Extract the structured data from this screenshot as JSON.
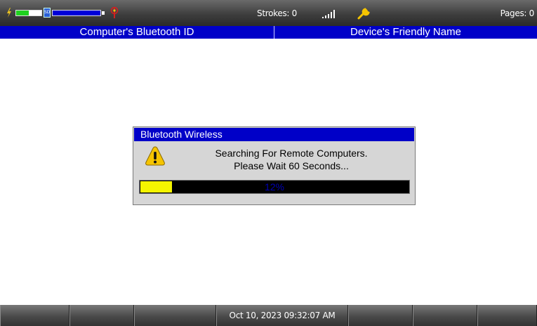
{
  "status_bar": {
    "strokes": "Strokes: 0",
    "pages": "Pages: 0",
    "icons": [
      "battery-charging-icon",
      "sd-card-icon",
      "usb-icon",
      "signal-strength-icon",
      "wrench-icon"
    ],
    "battery_level": 0.5,
    "sd_card_label": "SD",
    "storage_level": 1.0
  },
  "columns": {
    "computer_id": "Computer's Bluetooth ID",
    "friendly_name": "Device's Friendly Name"
  },
  "dialog": {
    "title": "Bluetooth Wireless",
    "line1": "Searching For Remote Computers.",
    "line2": "Please Wait 60 Seconds...",
    "progress_percent": 12,
    "progress_label": "12%",
    "icon": "warning-icon"
  },
  "bottom_bar": {
    "datetime": "Oct 10, 2023  09:32:07 AM"
  },
  "colors": {
    "header_blue": "#0000c8",
    "progress_yellow": "#f5f500",
    "battery_green": "#1fd11f",
    "warning_yellow": "#f5c400"
  }
}
